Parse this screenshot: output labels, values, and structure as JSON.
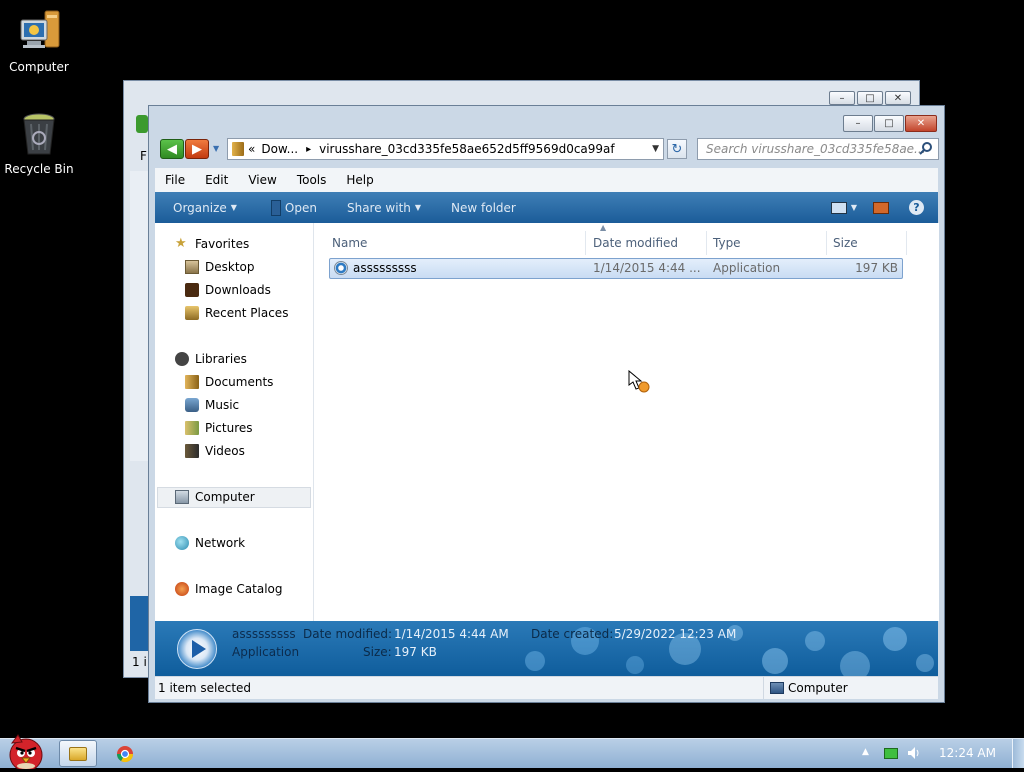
{
  "desktop": {
    "icons": [
      {
        "label": "Computer"
      },
      {
        "label": "Recycle Bin"
      }
    ]
  },
  "back_window": {
    "side_letter": "F",
    "status_fragment": "1 i"
  },
  "window": {
    "address": {
      "chevrons": "«",
      "segment1": "Dow...",
      "separator": "▸",
      "segment2": "virusshare_03cd335fe58ae652d5ff9569d0ca99af"
    },
    "search_placeholder": "Search virusshare_03cd335fe58ae...",
    "menu": [
      "File",
      "Edit",
      "View",
      "Tools",
      "Help"
    ],
    "toolbar": {
      "organize": "Organize",
      "open": "Open",
      "share_with": "Share with",
      "new_folder": "New folder"
    },
    "nav": {
      "favorites": "Favorites",
      "desktop": "Desktop",
      "downloads": "Downloads",
      "recent_places": "Recent Places",
      "libraries": "Libraries",
      "documents": "Documents",
      "music": "Music",
      "pictures": "Pictures",
      "videos": "Videos",
      "computer": "Computer",
      "network": "Network",
      "image_catalog": "Image Catalog"
    },
    "columns": {
      "name": "Name",
      "date_modified": "Date modified",
      "type": "Type",
      "size": "Size"
    },
    "files": [
      {
        "name": "asssssssss",
        "date_modified": "1/14/2015 4:44 ...",
        "type": "Application",
        "size": "197 KB"
      }
    ],
    "details": {
      "name": "asssssssss",
      "type": "Application",
      "date_modified_label": "Date modified:",
      "date_modified": "1/14/2015 4:44 AM",
      "date_created_label": "Date created:",
      "date_created": "5/29/2022 12:23 AM",
      "size_label": "Size:",
      "size": "197 KB"
    },
    "status": {
      "selected": "1 item selected",
      "location": "Computer"
    }
  },
  "taskbar": {
    "clock": "12:24 AM"
  }
}
